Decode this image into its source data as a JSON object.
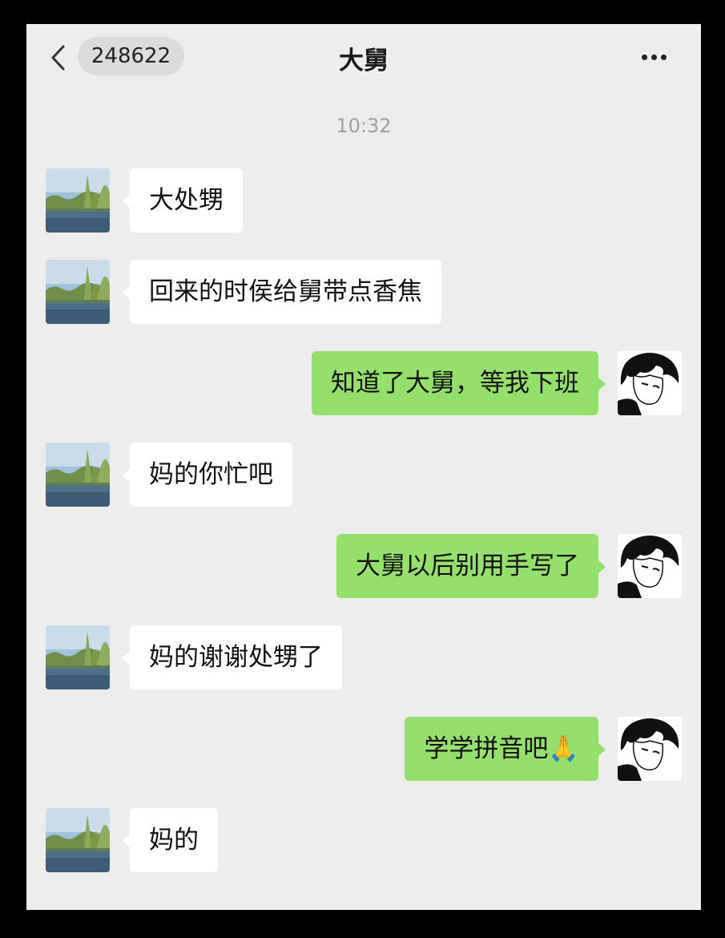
{
  "header": {
    "back_icon": "chevron-left-icon",
    "unread_badge": "248622",
    "title": "大舅",
    "more_icon": "more-dots-icon"
  },
  "chat": {
    "timestamp": "10:32",
    "messages": [
      {
        "side": "left",
        "text": "大处甥"
      },
      {
        "side": "left",
        "text": "回来的时侯给舅带点香焦"
      },
      {
        "side": "right",
        "text": "知道了大舅，等我下班"
      },
      {
        "side": "left",
        "text": "妈的你忙吧"
      },
      {
        "side": "right",
        "text": "大舅以后别用手写了"
      },
      {
        "side": "left",
        "text": "妈的谢谢处甥了"
      },
      {
        "side": "right",
        "text": "学学拼音吧🙏"
      },
      {
        "side": "left",
        "text": "妈的"
      }
    ]
  },
  "colors": {
    "background": "#ededed",
    "bubble_sent": "#95e06c",
    "bubble_received": "#ffffff"
  }
}
